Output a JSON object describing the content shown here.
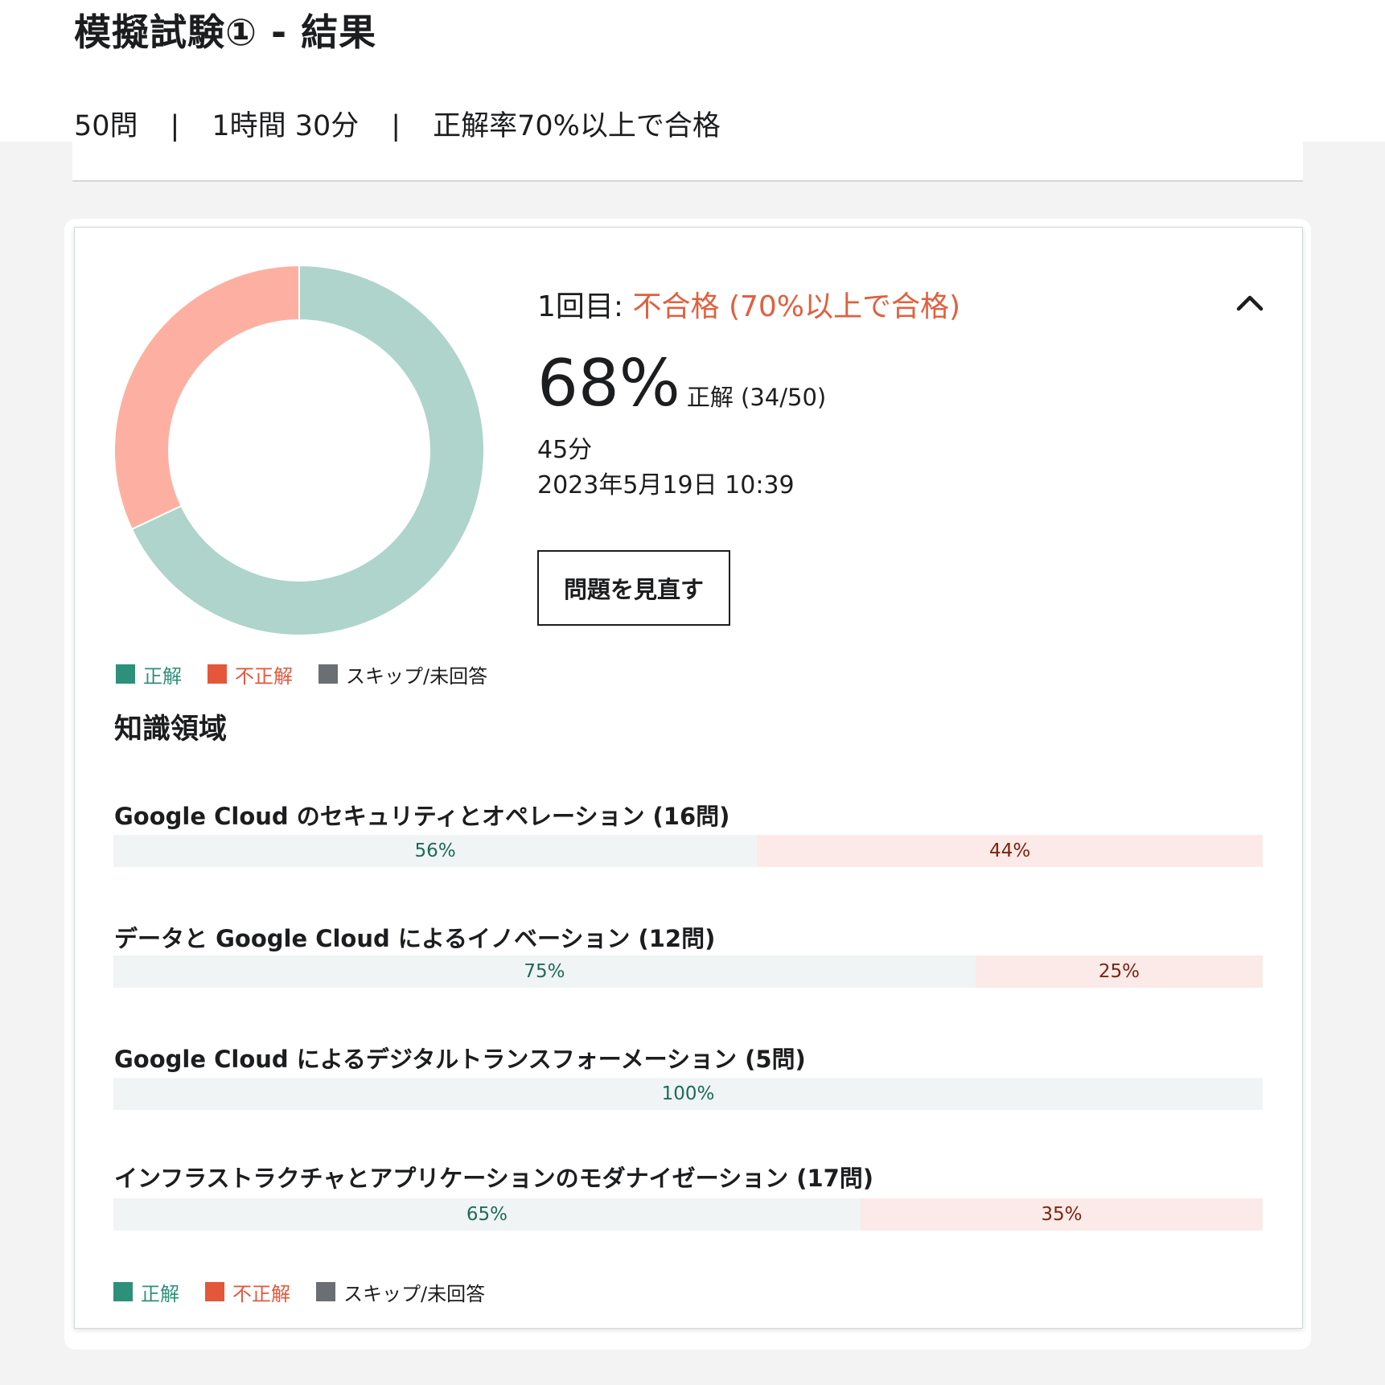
{
  "page": {
    "title": "模擬試験① - 結果",
    "meta": {
      "questions": "50問",
      "separator": "|",
      "time_limit": "1時間 30分",
      "pass_criteria": "正解率70%以上で合格"
    }
  },
  "result": {
    "attempt_label": "1回目:",
    "status": "不合格 (70%以上で合格)",
    "score_percent": "68%",
    "score_detail": "正解 (34/50)",
    "duration": "45分",
    "datetime": "2023年5月19日 10:39",
    "review_button": "問題を見直す",
    "collapse_icon": "chevron-up-icon"
  },
  "chart_data": {
    "type": "pie",
    "donut": true,
    "slices": [
      {
        "label": "正解",
        "value": 34
      },
      {
        "label": "不正解",
        "value": 16
      }
    ],
    "colors": {
      "correct": "#aed4cb",
      "incorrect": "#fdb0a1"
    }
  },
  "legend": {
    "items": [
      {
        "label": "正解",
        "color": "#2d907a",
        "text_color": "#2d907a"
      },
      {
        "label": "不正解",
        "color": "#e4573b",
        "text_color": "#e4573b"
      },
      {
        "label": "スキップ/未回答",
        "color": "#6a6f73",
        "text_color": "#1c1d1f"
      }
    ]
  },
  "knowledge": {
    "title": "知識領域",
    "domains": [
      {
        "name": "Google Cloud のセキュリティとオペレーション (16問)",
        "correct": 56,
        "incorrect": 44,
        "correct_label": "56%",
        "incorrect_label": "44%"
      },
      {
        "name": "データと Google Cloud によるイノベーション (12問)",
        "correct": 75,
        "incorrect": 25,
        "correct_label": "75%",
        "incorrect_label": "25%"
      },
      {
        "name": "Google Cloud によるデジタルトランスフォーメーション (5問)",
        "correct": 100,
        "incorrect": 0,
        "correct_label": "100%",
        "incorrect_label": ""
      },
      {
        "name": "インフラストラクチャとアプリケーションのモダナイゼーション (17問)",
        "correct": 65,
        "incorrect": 35,
        "correct_label": "65%",
        "incorrect_label": "35%"
      }
    ]
  }
}
